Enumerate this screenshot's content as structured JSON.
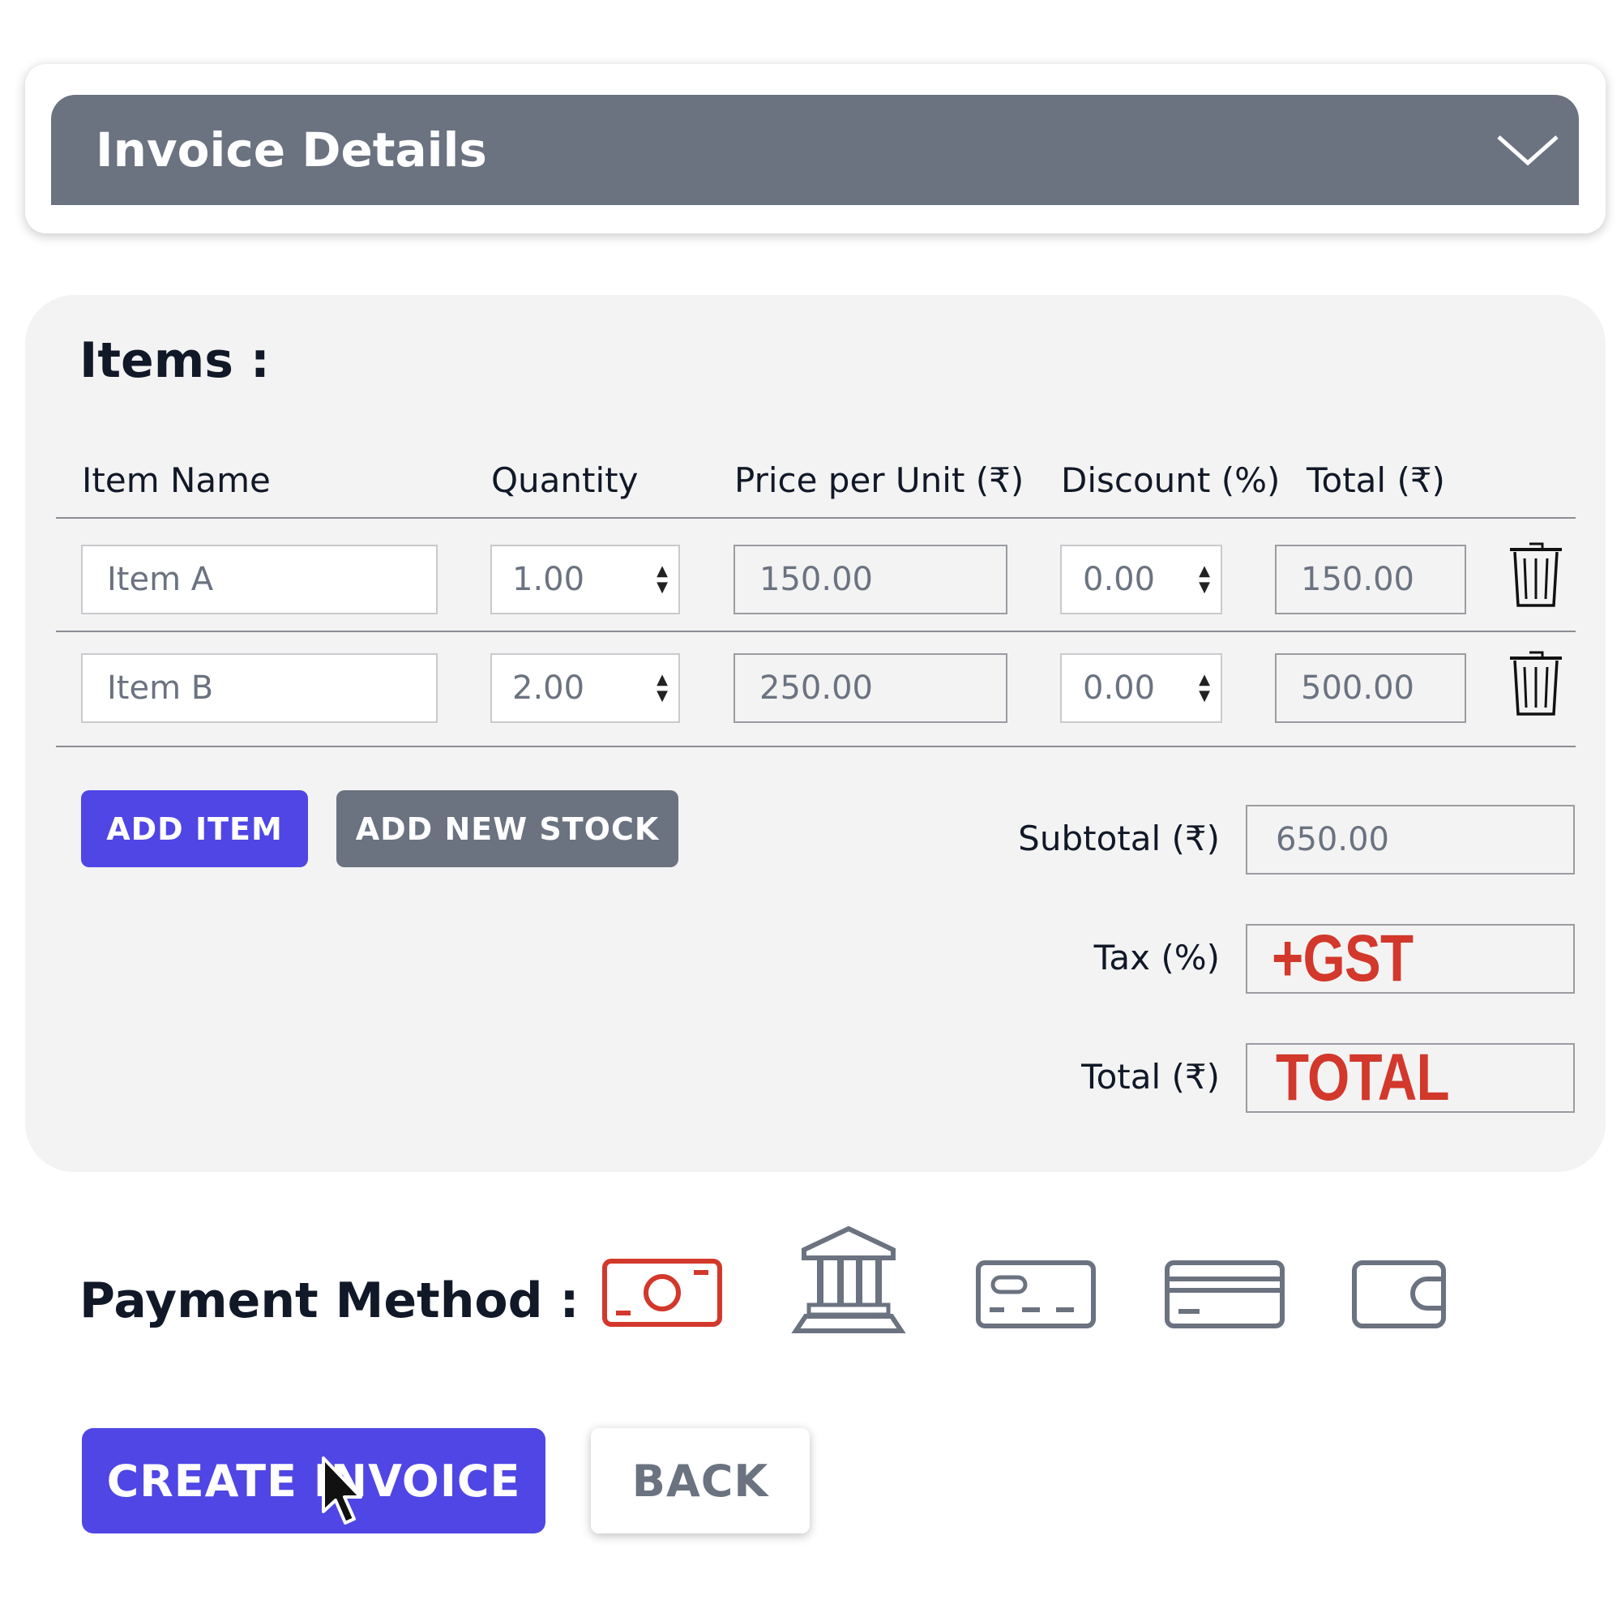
{
  "header": {
    "title": "Invoice Details",
    "chevron_icon": "chevron-down-icon"
  },
  "items": {
    "heading": "Items :",
    "columns": [
      "Item Name",
      "Quantity",
      "Price per Unit (₹)",
      "Discount (%)",
      "Total (₹)"
    ],
    "rows": [
      {
        "name": "Item A",
        "quantity": "1.00",
        "price": "150.00",
        "discount": "0.00",
        "total": "150.00"
      },
      {
        "name": "Item B",
        "quantity": "2.00",
        "price": "250.00",
        "discount": "0.00",
        "total": "500.00"
      }
    ],
    "add_item_label": "ADD ITEM",
    "add_stock_label": "ADD NEW STOCK"
  },
  "summary": {
    "subtotal_label": "Subtotal (₹)",
    "subtotal_value": "650.00",
    "tax_label": "Tax (%)",
    "tax_value": "+GST",
    "total_label": "Total (₹)",
    "total_value": "TOTAL"
  },
  "payment": {
    "label": "Payment Method :",
    "methods": [
      "cash-icon",
      "bank-icon",
      "id-card-icon",
      "credit-card-icon",
      "wallet-icon"
    ],
    "selected_color": "#d2382b",
    "icon_color": "#6b7280"
  },
  "actions": {
    "create_label": "CREATE INVOICE",
    "back_label": "BACK"
  },
  "colors": {
    "primary": "#4f46e5",
    "header": "#6b7280",
    "panel": "#f3f3f3"
  }
}
